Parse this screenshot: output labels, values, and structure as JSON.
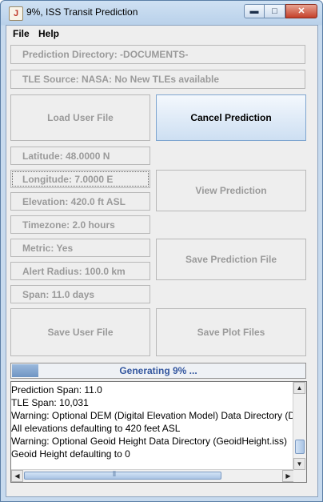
{
  "window": {
    "title": "9%, ISS Transit Prediction",
    "min_glyph": "▬",
    "max_glyph": "□",
    "close_glyph": "✕",
    "icon_glyph": "J"
  },
  "menu": {
    "file": "File",
    "help": "Help"
  },
  "fields": {
    "prediction_directory": "Prediction Directory: -DOCUMENTS-",
    "tle_source": "TLE Source: NASA: No New TLEs available",
    "latitude": "Latitude: 48.0000 N",
    "longitude": "Longitude: 7.0000 E",
    "elevation": "Elevation: 420.0 ft ASL",
    "timezone": "Timezone: 2.0 hours",
    "metric": "Metric: Yes",
    "alert_radius": "Alert Radius: 100.0 km",
    "span": "Span: 11.0 days"
  },
  "buttons": {
    "load_user_file": "Load User File",
    "cancel_prediction": "Cancel Prediction",
    "view_prediction": "View Prediction",
    "save_prediction_file": "Save Prediction File",
    "save_user_file": "Save User File",
    "save_plot_files": "Save Plot Files"
  },
  "progress": {
    "label": "Generating 9% ...",
    "fraction": 0.09
  },
  "log": {
    "lines": [
      "    Prediction Span: 11.0",
      "    TLE Span: 10,031",
      "Warning: Optional DEM (Digital Elevation Model) Data Directory (D",
      "All elevations defaulting to 420 feet ASL",
      "Warning: Optional Geoid Height Data Directory (GeoidHeight.iss)",
      "Geoid Height defaulting to 0"
    ]
  },
  "scroll": {
    "up": "▲",
    "down": "▼",
    "left": "◀",
    "right": "▶",
    "grip": "⦀"
  }
}
